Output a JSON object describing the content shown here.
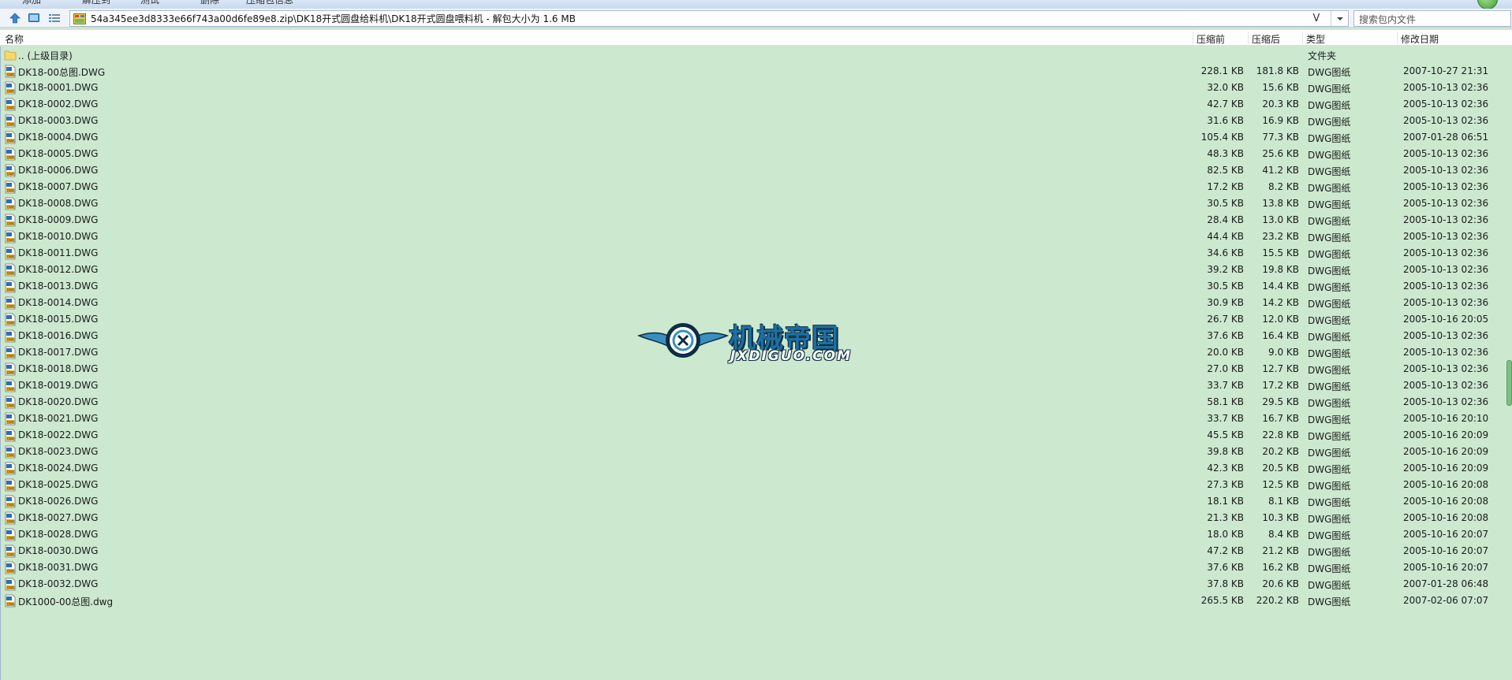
{
  "toolbar": {
    "items": [
      "添加",
      "解压到",
      "测试",
      "删除",
      "压缩包信息"
    ]
  },
  "address": {
    "path": "54a345ee3d8333e66f743a00d6fe89e8.zip\\DK18开式圆盘给料机\\DK18开式圆盘喂料机 - 解包大小为 1.6 MB",
    "v_glyph": "V",
    "search_placeholder": "搜索包内文件"
  },
  "columns": {
    "name": "名称",
    "packed": "压缩前",
    "size": "压缩后",
    "type": "类型",
    "modified": "修改日期"
  },
  "parent_row": {
    "name": ".. (上级目录)",
    "type": "文件夹"
  },
  "files": [
    {
      "name": "DK18-00总图.DWG",
      "packed": "228.1 KB",
      "size": "181.8 KB",
      "type": "DWG图纸",
      "date": "2007-10-27 21:31"
    },
    {
      "name": "DK18-0001.DWG",
      "packed": "32.0 KB",
      "size": "15.6 KB",
      "type": "DWG图纸",
      "date": "2005-10-13 02:36"
    },
    {
      "name": "DK18-0002.DWG",
      "packed": "42.7 KB",
      "size": "20.3 KB",
      "type": "DWG图纸",
      "date": "2005-10-13 02:36"
    },
    {
      "name": "DK18-0003.DWG",
      "packed": "31.6 KB",
      "size": "16.9 KB",
      "type": "DWG图纸",
      "date": "2005-10-13 02:36"
    },
    {
      "name": "DK18-0004.DWG",
      "packed": "105.4 KB",
      "size": "77.3 KB",
      "type": "DWG图纸",
      "date": "2007-01-28 06:51"
    },
    {
      "name": "DK18-0005.DWG",
      "packed": "48.3 KB",
      "size": "25.6 KB",
      "type": "DWG图纸",
      "date": "2005-10-13 02:36"
    },
    {
      "name": "DK18-0006.DWG",
      "packed": "82.5 KB",
      "size": "41.2 KB",
      "type": "DWG图纸",
      "date": "2005-10-13 02:36"
    },
    {
      "name": "DK18-0007.DWG",
      "packed": "17.2 KB",
      "size": "8.2 KB",
      "type": "DWG图纸",
      "date": "2005-10-13 02:36"
    },
    {
      "name": "DK18-0008.DWG",
      "packed": "30.5 KB",
      "size": "13.8 KB",
      "type": "DWG图纸",
      "date": "2005-10-13 02:36"
    },
    {
      "name": "DK18-0009.DWG",
      "packed": "28.4 KB",
      "size": "13.0 KB",
      "type": "DWG图纸",
      "date": "2005-10-13 02:36"
    },
    {
      "name": "DK18-0010.DWG",
      "packed": "44.4 KB",
      "size": "23.2 KB",
      "type": "DWG图纸",
      "date": "2005-10-13 02:36"
    },
    {
      "name": "DK18-0011.DWG",
      "packed": "34.6 KB",
      "size": "15.5 KB",
      "type": "DWG图纸",
      "date": "2005-10-13 02:36"
    },
    {
      "name": "DK18-0012.DWG",
      "packed": "39.2 KB",
      "size": "19.8 KB",
      "type": "DWG图纸",
      "date": "2005-10-13 02:36"
    },
    {
      "name": "DK18-0013.DWG",
      "packed": "30.5 KB",
      "size": "14.4 KB",
      "type": "DWG图纸",
      "date": "2005-10-13 02:36"
    },
    {
      "name": "DK18-0014.DWG",
      "packed": "30.9 KB",
      "size": "14.2 KB",
      "type": "DWG图纸",
      "date": "2005-10-13 02:36"
    },
    {
      "name": "DK18-0015.DWG",
      "packed": "26.7 KB",
      "size": "12.0 KB",
      "type": "DWG图纸",
      "date": "2005-10-16 20:05"
    },
    {
      "name": "DK18-0016.DWG",
      "packed": "37.6 KB",
      "size": "16.4 KB",
      "type": "DWG图纸",
      "date": "2005-10-13 02:36"
    },
    {
      "name": "DK18-0017.DWG",
      "packed": "20.0 KB",
      "size": "9.0 KB",
      "type": "DWG图纸",
      "date": "2005-10-13 02:36"
    },
    {
      "name": "DK18-0018.DWG",
      "packed": "27.0 KB",
      "size": "12.7 KB",
      "type": "DWG图纸",
      "date": "2005-10-13 02:36"
    },
    {
      "name": "DK18-0019.DWG",
      "packed": "33.7 KB",
      "size": "17.2 KB",
      "type": "DWG图纸",
      "date": "2005-10-13 02:36"
    },
    {
      "name": "DK18-0020.DWG",
      "packed": "58.1 KB",
      "size": "29.5 KB",
      "type": "DWG图纸",
      "date": "2005-10-13 02:36"
    },
    {
      "name": "DK18-0021.DWG",
      "packed": "33.7 KB",
      "size": "16.7 KB",
      "type": "DWG图纸",
      "date": "2005-10-16 20:10"
    },
    {
      "name": "DK18-0022.DWG",
      "packed": "45.5 KB",
      "size": "22.8 KB",
      "type": "DWG图纸",
      "date": "2005-10-16 20:09"
    },
    {
      "name": "DK18-0023.DWG",
      "packed": "39.8 KB",
      "size": "20.2 KB",
      "type": "DWG图纸",
      "date": "2005-10-16 20:09"
    },
    {
      "name": "DK18-0024.DWG",
      "packed": "42.3 KB",
      "size": "20.5 KB",
      "type": "DWG图纸",
      "date": "2005-10-16 20:09"
    },
    {
      "name": "DK18-0025.DWG",
      "packed": "27.3 KB",
      "size": "12.5 KB",
      "type": "DWG图纸",
      "date": "2005-10-16 20:08"
    },
    {
      "name": "DK18-0026.DWG",
      "packed": "18.1 KB",
      "size": "8.1 KB",
      "type": "DWG图纸",
      "date": "2005-10-16 20:08"
    },
    {
      "name": "DK18-0027.DWG",
      "packed": "21.3 KB",
      "size": "10.3 KB",
      "type": "DWG图纸",
      "date": "2005-10-16 20:08"
    },
    {
      "name": "DK18-0028.DWG",
      "packed": "18.0 KB",
      "size": "8.4 KB",
      "type": "DWG图纸",
      "date": "2005-10-16 20:07"
    },
    {
      "name": "DK18-0030.DWG",
      "packed": "47.2 KB",
      "size": "21.2 KB",
      "type": "DWG图纸",
      "date": "2005-10-16 20:07"
    },
    {
      "name": "DK18-0031.DWG",
      "packed": "37.6 KB",
      "size": "16.2 KB",
      "type": "DWG图纸",
      "date": "2005-10-16 20:07"
    },
    {
      "name": "DK18-0032.DWG",
      "packed": "37.8 KB",
      "size": "20.6 KB",
      "type": "DWG图纸",
      "date": "2007-01-28 06:48"
    },
    {
      "name": "DK1000-00总图.dwg",
      "packed": "265.5 KB",
      "size": "220.2 KB",
      "type": "DWG图纸",
      "date": "2007-02-06 07:07"
    }
  ],
  "watermark": {
    "cn": "机械帝国",
    "en": "JXDIGUO.COM"
  },
  "colors": {
    "list_background": "#cce8cf",
    "header_background": "#ffffff",
    "address_bar": "#f0f4fa"
  }
}
